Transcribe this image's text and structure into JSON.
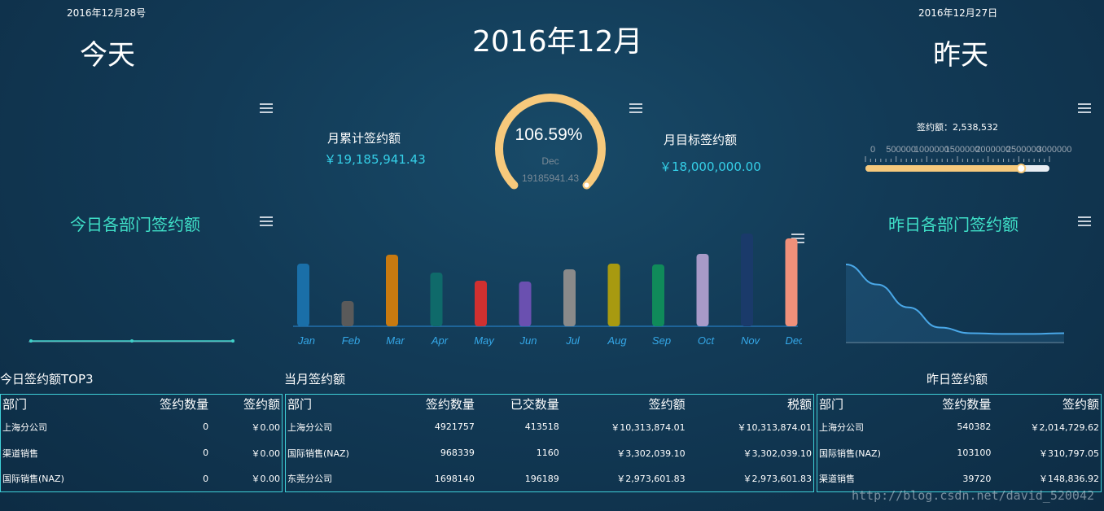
{
  "header": {
    "today_date": "2016年12月28号",
    "today_title": "今天",
    "main_title": "2016年12月",
    "yesterday_date": "2016年12月27日",
    "yesterday_title": "昨天"
  },
  "kpis": {
    "monthly_total_label": "月累计签约额",
    "monthly_total_value": "￥19,185,941.43",
    "monthly_target_label": "月目标签约额",
    "monthly_target_value": "￥18,000,000.00"
  },
  "gauge": {
    "percent_text": "106.59%",
    "percent": 106.59,
    "month": "Dec",
    "value": "19185941.43",
    "arc_color": "#f6c97c"
  },
  "slider": {
    "label": "签约额：2,538,532",
    "value": 2538532,
    "min": 0,
    "max": 3000000,
    "ticks": [
      "0",
      "500000",
      "1000000",
      "1500000",
      "2000000",
      "2500000",
      "3000000"
    ],
    "fill_color": "#f6c97c"
  },
  "sections": {
    "today_dept_title": "今日各部门签约额",
    "yesterday_dept_title": "昨日各部门签约额"
  },
  "chart_data": [
    {
      "type": "bar",
      "categories": [
        "Jan",
        "Feb",
        "Mar",
        "Apr",
        "May",
        "Jun",
        "Jul",
        "Aug",
        "Sep",
        "Oct",
        "Nov",
        "Dec"
      ],
      "values": [
        77,
        31,
        88,
        66,
        56,
        55,
        70,
        77,
        76,
        89,
        114,
        108
      ],
      "colors": [
        "#1a6fa8",
        "#5a5a5a",
        "#c87a10",
        "#0f6a6a",
        "#d03030",
        "#6a50b0",
        "#8a8a8a",
        "#a89a10",
        "#108a5a",
        "#a89ac8",
        "#1a3a6a",
        "#f0907a"
      ]
    },
    {
      "type": "area",
      "series": [
        {
          "values": [
            100,
            72,
            40,
            12,
            4,
            3,
            3,
            4
          ]
        }
      ],
      "color": "#4aa8e8"
    },
    {
      "type": "line",
      "series": [
        {
          "values": [
            0,
            0,
            0
          ]
        }
      ],
      "color": "#3fd0c8"
    }
  ],
  "tables": {
    "today_top3": {
      "title": "今日签约额TOP3",
      "headers": [
        "部门",
        "签约数量",
        "签约额"
      ],
      "rows": [
        [
          "上海分公司",
          "0",
          "￥0.00"
        ],
        [
          "渠道销售",
          "0",
          "￥0.00"
        ],
        [
          "国际销售(NAZ)",
          "0",
          "￥0.00"
        ]
      ]
    },
    "month": {
      "title": "当月签约额",
      "headers": [
        "部门",
        "签约数量",
        "已交数量",
        "签约额",
        "税额"
      ],
      "rows": [
        [
          "上海分公司",
          "4921757",
          "413518",
          "￥10,313,874.01",
          "￥10,313,874.01"
        ],
        [
          "国际销售(NAZ)",
          "968339",
          "1160",
          "￥3,302,039.10",
          "￥3,302,039.10"
        ],
        [
          "东莞分公司",
          "1698140",
          "196189",
          "￥2,973,601.83",
          "￥2,973,601.83"
        ]
      ]
    },
    "yesterday": {
      "title": "昨日签约额",
      "headers": [
        "部门",
        "签约数量",
        "签约额"
      ],
      "rows": [
        [
          "上海分公司",
          "540382",
          "￥2,014,729.62"
        ],
        [
          "国际销售(NAZ)",
          "103100",
          "￥310,797.05"
        ],
        [
          "渠道销售",
          "39720",
          "￥148,836.92"
        ]
      ]
    }
  },
  "watermark": "http://blog.csdn.net/david_520042"
}
